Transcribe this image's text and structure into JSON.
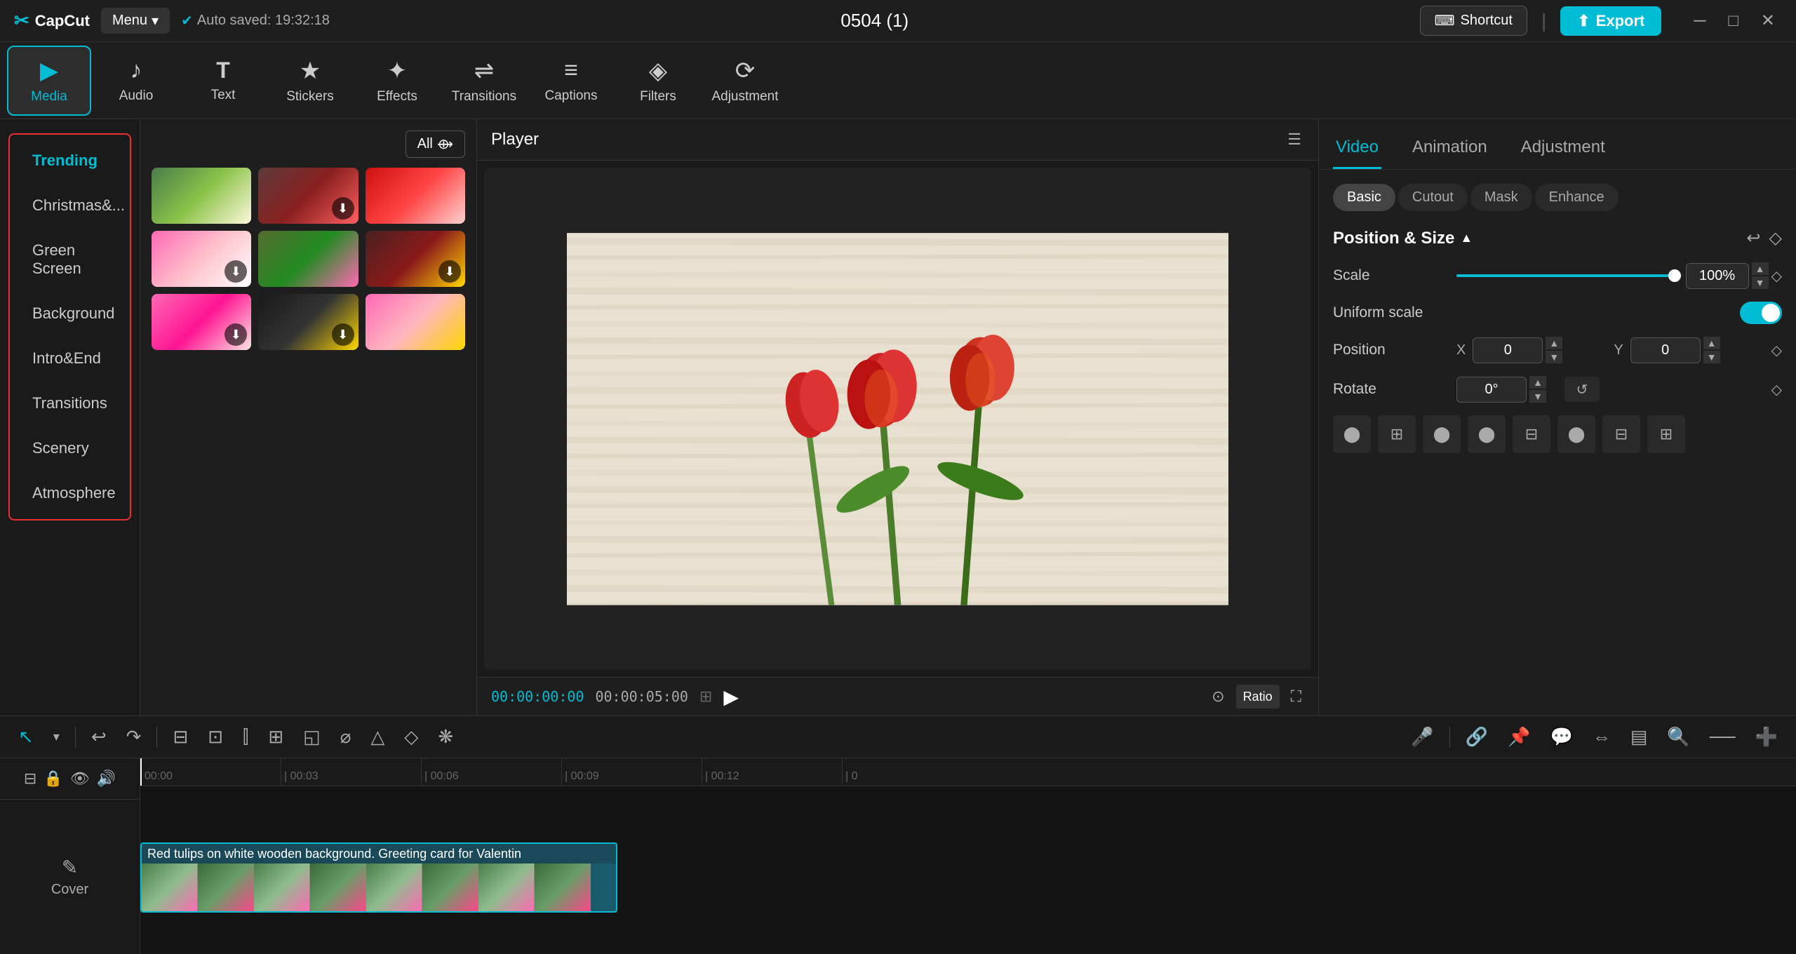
{
  "app": {
    "name": "CapCut",
    "title": "0504 (1)",
    "autosave": "Auto saved: 19:32:18"
  },
  "topbar": {
    "menu_label": "Menu",
    "shortcut_label": "Shortcut",
    "export_label": "Export"
  },
  "toolbar": {
    "items": [
      {
        "id": "media",
        "label": "Media",
        "icon": "▶",
        "active": true
      },
      {
        "id": "audio",
        "label": "Audio",
        "icon": "♪",
        "active": false
      },
      {
        "id": "text",
        "label": "Text",
        "icon": "T",
        "active": false
      },
      {
        "id": "stickers",
        "label": "Stickers",
        "icon": "★",
        "active": false
      },
      {
        "id": "effects",
        "label": "Effects",
        "icon": "✦",
        "active": false
      },
      {
        "id": "transitions",
        "label": "Transitions",
        "icon": "⇌",
        "active": false
      },
      {
        "id": "captions",
        "label": "Captions",
        "icon": "≡",
        "active": false
      },
      {
        "id": "filters",
        "label": "Filters",
        "icon": "◈",
        "active": false
      },
      {
        "id": "adjustment",
        "label": "Adjustment",
        "icon": "⟳",
        "active": false
      }
    ]
  },
  "categories": [
    {
      "id": "trending",
      "label": "Trending",
      "active": true
    },
    {
      "id": "christmas",
      "label": "Christmas&...",
      "active": false
    },
    {
      "id": "green-screen",
      "label": "Green Screen",
      "active": false
    },
    {
      "id": "background",
      "label": "Background",
      "active": false
    },
    {
      "id": "intro-end",
      "label": "Intro&End",
      "active": false
    },
    {
      "id": "transitions",
      "label": "Transitions",
      "active": false
    },
    {
      "id": "scenery",
      "label": "Scenery",
      "active": false
    },
    {
      "id": "atmosphere",
      "label": "Atmosphere",
      "active": false
    }
  ],
  "media_header": {
    "all_label": "All"
  },
  "player": {
    "title": "Player",
    "time_current": "00:00:00:00",
    "time_end": "00:00:05:00",
    "ratio_label": "Ratio"
  },
  "right_panel": {
    "tabs": [
      "Video",
      "Animation",
      "Adjustment"
    ],
    "active_tab": "Video",
    "sub_tabs": [
      "Basic",
      "Cutout",
      "Mask",
      "Enhance"
    ],
    "active_sub_tab": "Basic",
    "position_size": {
      "label": "Position & Size",
      "scale_label": "Scale",
      "scale_value": "100%",
      "uniform_scale_label": "Uniform scale",
      "position_label": "Position",
      "x_label": "X",
      "x_value": "0",
      "y_label": "Y",
      "y_value": "0",
      "rotate_label": "Rotate",
      "rotate_value": "0°"
    }
  },
  "bottom_toolbar": {
    "tools": [
      "↖",
      "↩",
      "↷",
      "⊟",
      "⫿",
      "⊞",
      "⊡",
      "◻",
      "◱",
      "⌀",
      "△",
      "◇",
      "❋",
      "⬡"
    ]
  },
  "timeline": {
    "cover_label": "Cover",
    "clip_title": "Red tulips on white wooden background. Greeting card for Valentin",
    "ruler_marks": [
      "00:00",
      "| 00:03",
      "| 00:06",
      "| 00:09",
      "| 00:12",
      "| 0"
    ]
  }
}
